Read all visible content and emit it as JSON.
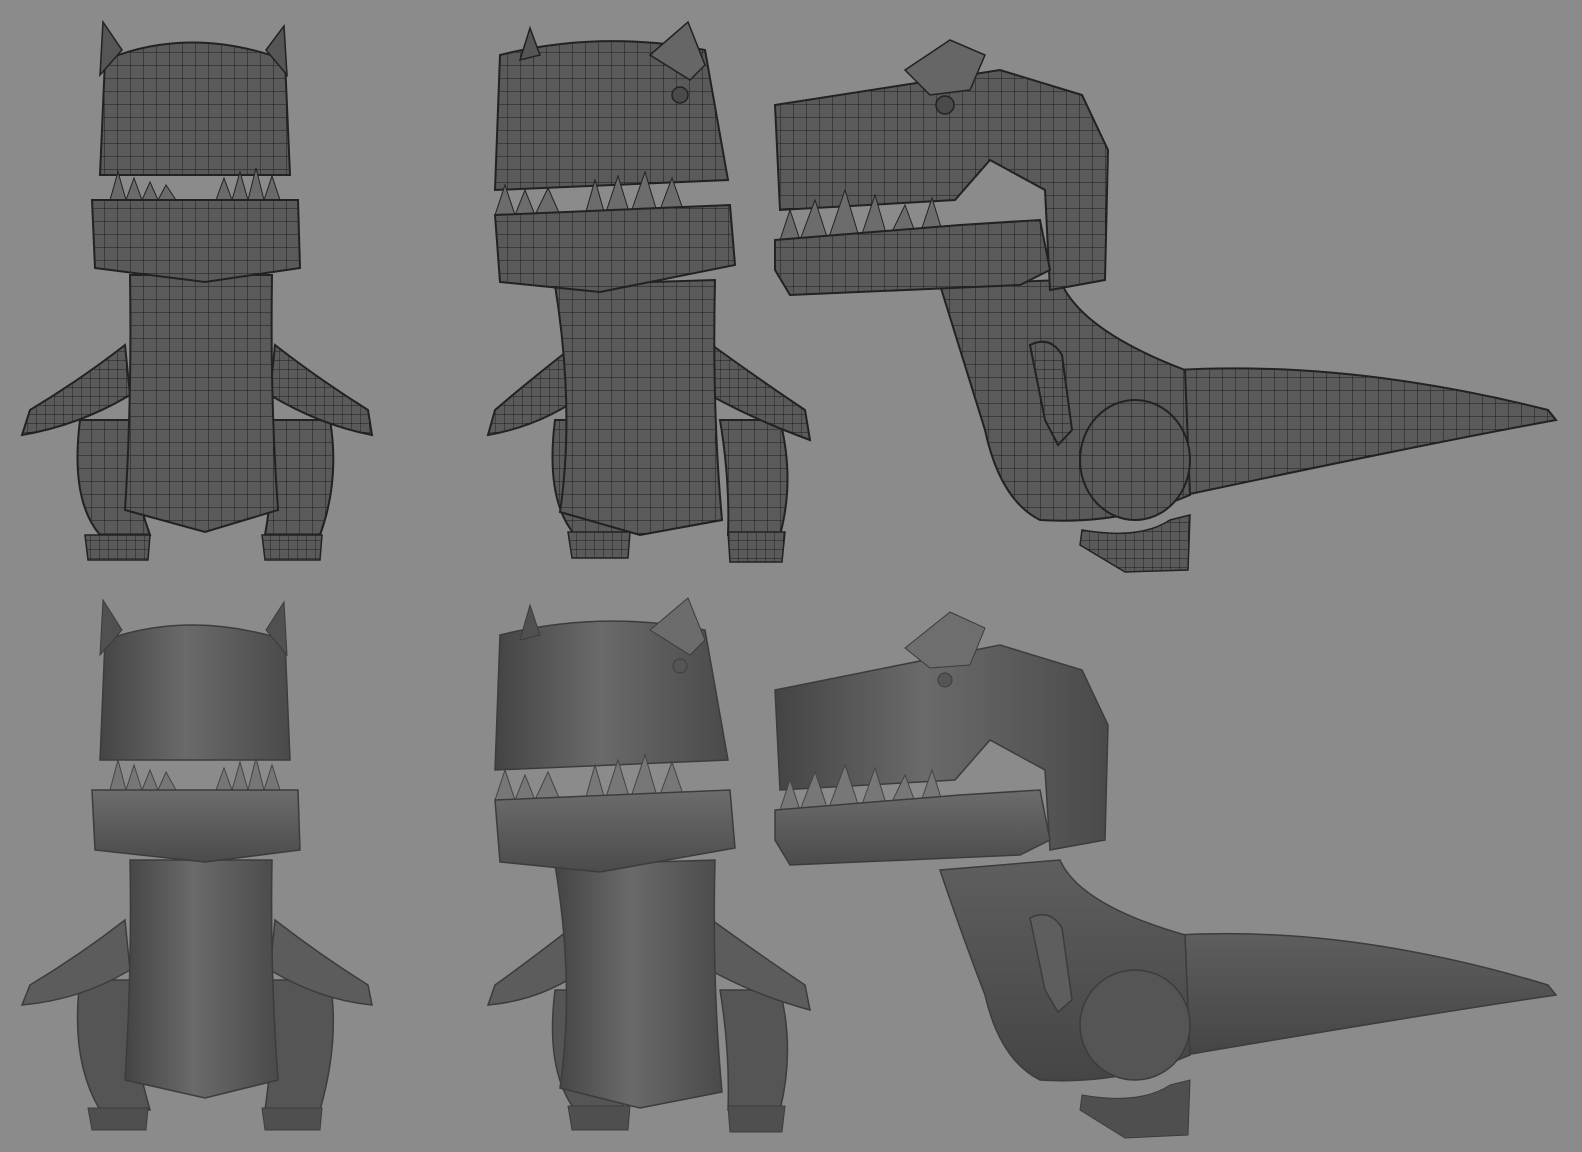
{
  "scene": {
    "subject": "cartoon-t-rex-3d-model",
    "background_color": "#8b8b8b",
    "model_color": "#5b5b5b",
    "wire_color": "#1e1e1e",
    "views": [
      {
        "id": "front",
        "mode": "wireframe"
      },
      {
        "id": "three-quarter",
        "mode": "wireframe"
      },
      {
        "id": "side",
        "mode": "wireframe"
      },
      {
        "id": "front",
        "mode": "shaded"
      },
      {
        "id": "three-quarter",
        "mode": "shaded"
      },
      {
        "id": "side",
        "mode": "shaded"
      }
    ]
  }
}
